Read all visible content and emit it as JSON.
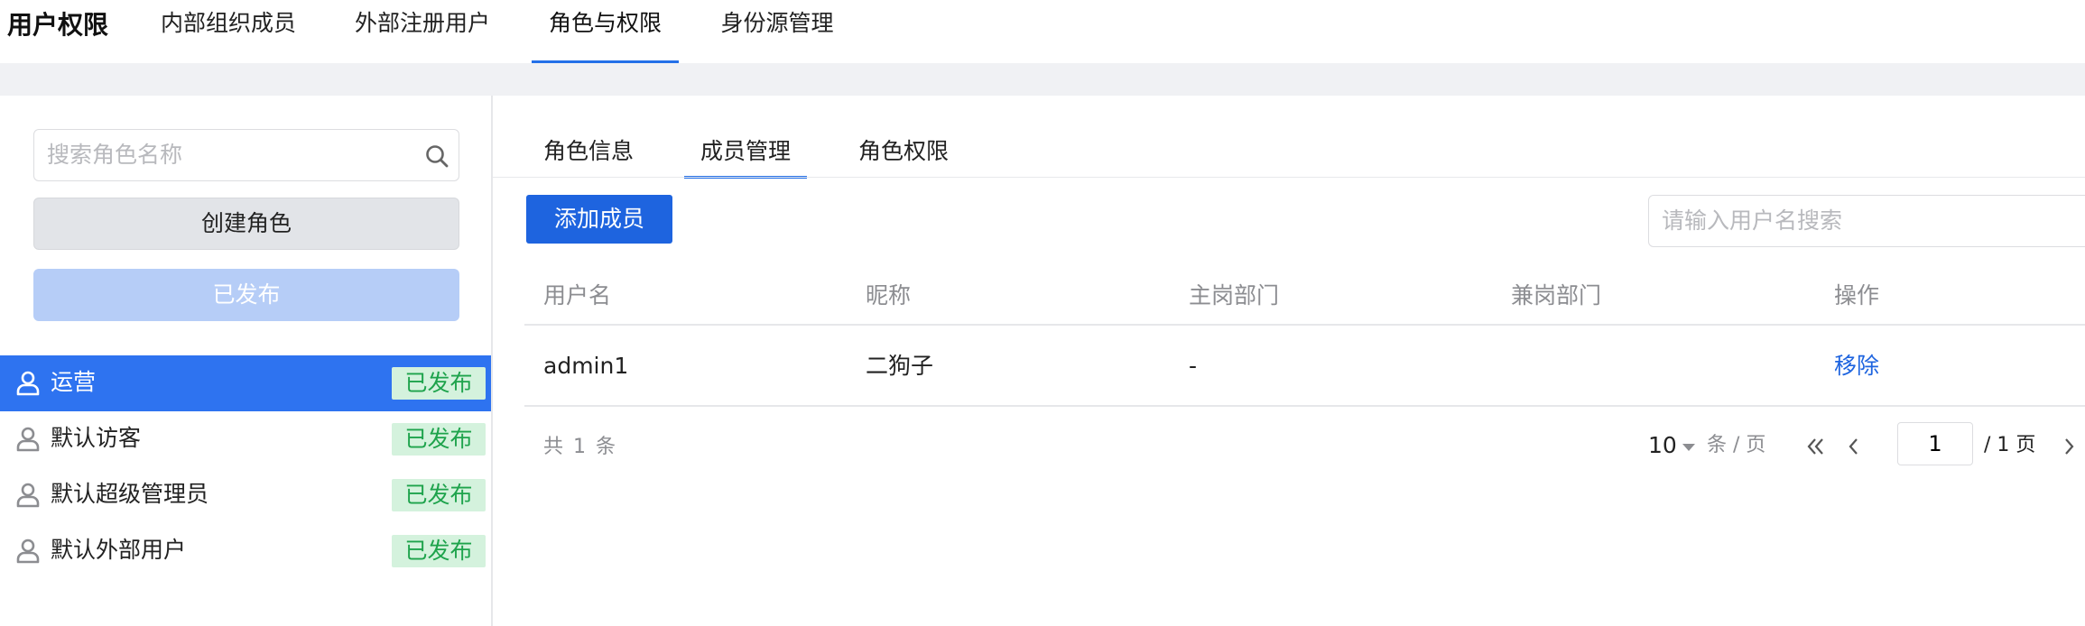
{
  "app": {
    "title": "用户权限"
  },
  "top_tabs": [
    {
      "label": "内部组织成员"
    },
    {
      "label": "外部注册用户"
    },
    {
      "label": "角色与权限",
      "active": true
    },
    {
      "label": "身份源管理"
    }
  ],
  "sidebar": {
    "search_placeholder": "搜索角色名称",
    "create_label": "创建角色",
    "published_label": "已发布",
    "roles": [
      {
        "name": "运营",
        "badge": "已发布",
        "active": true
      },
      {
        "name": "默认访客",
        "badge": "已发布"
      },
      {
        "name": "默认超级管理员",
        "badge": "已发布"
      },
      {
        "name": "默认外部用户",
        "badge": "已发布"
      }
    ]
  },
  "main": {
    "tabs": [
      {
        "label": "角色信息"
      },
      {
        "label": "成员管理",
        "active": true
      },
      {
        "label": "角色权限"
      }
    ],
    "add_member_label": "添加成员",
    "user_search_placeholder": "请输入用户名搜索",
    "table": {
      "headers": [
        "用户名",
        "昵称",
        "主岗部门",
        "兼岗部门",
        "操作"
      ],
      "rows": [
        {
          "username": "admin1",
          "nickname": "二狗子",
          "main_dept": "-",
          "part_dept": "",
          "action": "移除"
        }
      ]
    },
    "pagination": {
      "total_text": "共 1 条",
      "page_size": "10",
      "per_page_text": "条 / 页",
      "current_page": "1",
      "page_total_text": "/ 1 页"
    }
  },
  "colors": {
    "accent": "#2470e8",
    "primary_button": "#1e64df",
    "active_role_bg": "#2e73f0",
    "badge_bg": "#d4f2dd",
    "badge_text": "#1ea34c"
  }
}
